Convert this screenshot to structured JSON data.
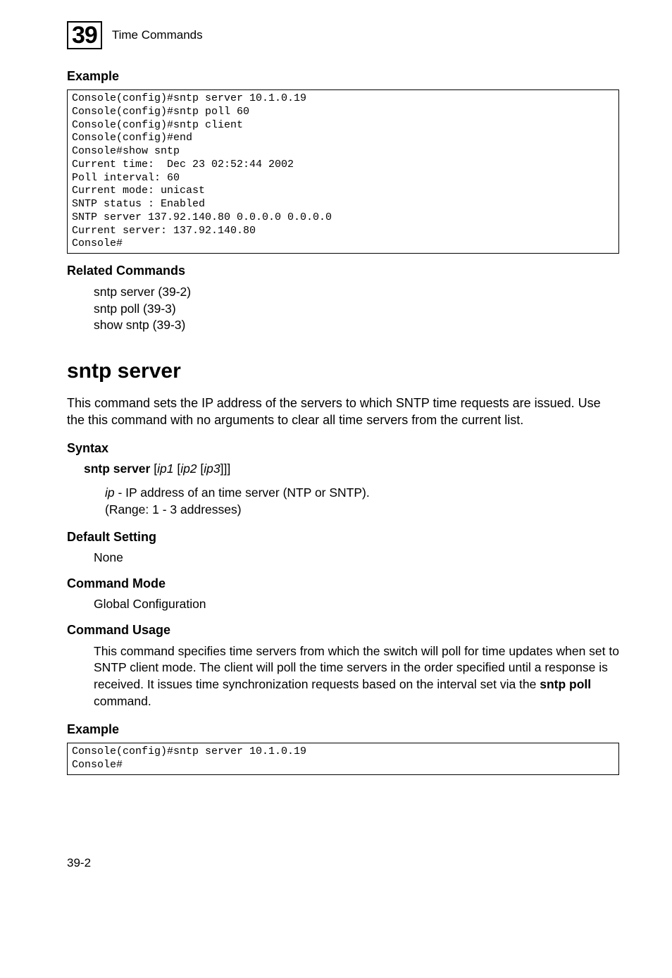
{
  "header": {
    "chapter_num": "39",
    "chapter_title": "Time Commands"
  },
  "sec_example1": "Example",
  "code1": "Console(config)#sntp server 10.1.0.19\nConsole(config)#sntp poll 60\nConsole(config)#sntp client\nConsole(config)#end\nConsole#show sntp\nCurrent time:  Dec 23 02:52:44 2002\nPoll interval: 60\nCurrent mode: unicast\nSNTP status : Enabled\nSNTP server 137.92.140.80 0.0.0.0 0.0.0.0\nCurrent server: 137.92.140.80\nConsole#",
  "sec_related": "Related Commands",
  "related": {
    "l1": "sntp server (39-2)",
    "l2": "sntp poll (39-3)",
    "l3": "show sntp (39-3)"
  },
  "cmd_name": "sntp server",
  "intro": "This command sets the IP address of the servers to which SNTP time requests are issued. Use the this command with no arguments to clear all time servers from the current list.",
  "sec_syntax": "Syntax",
  "syntax": {
    "cmd": "sntp server",
    "open1": " [",
    "ip1": "ip1",
    "open2": " [",
    "ip2": "ip2",
    "open3": " [",
    "ip3": "ip3",
    "close": "]]]",
    "desc_ip": "ip",
    "desc_rest": " - IP address of an time server (NTP or SNTP).",
    "range": "(Range: 1 - 3 addresses)"
  },
  "sec_default": "Default Setting",
  "default_val": "None",
  "sec_mode": "Command Mode",
  "mode_val": "Global Configuration",
  "sec_usage": "Command Usage",
  "usage_p1": "This command specifies time servers from which the switch will poll for time updates when set to SNTP client mode. The client will poll the time servers in the order specified until a response is received. It issues time synchronization requests based on the interval set via the ",
  "usage_bold": "sntp poll",
  "usage_p2": " command.",
  "sec_example2": "Example",
  "code2": "Console(config)#sntp server 10.1.0.19\nConsole#",
  "page_num": "39-2"
}
